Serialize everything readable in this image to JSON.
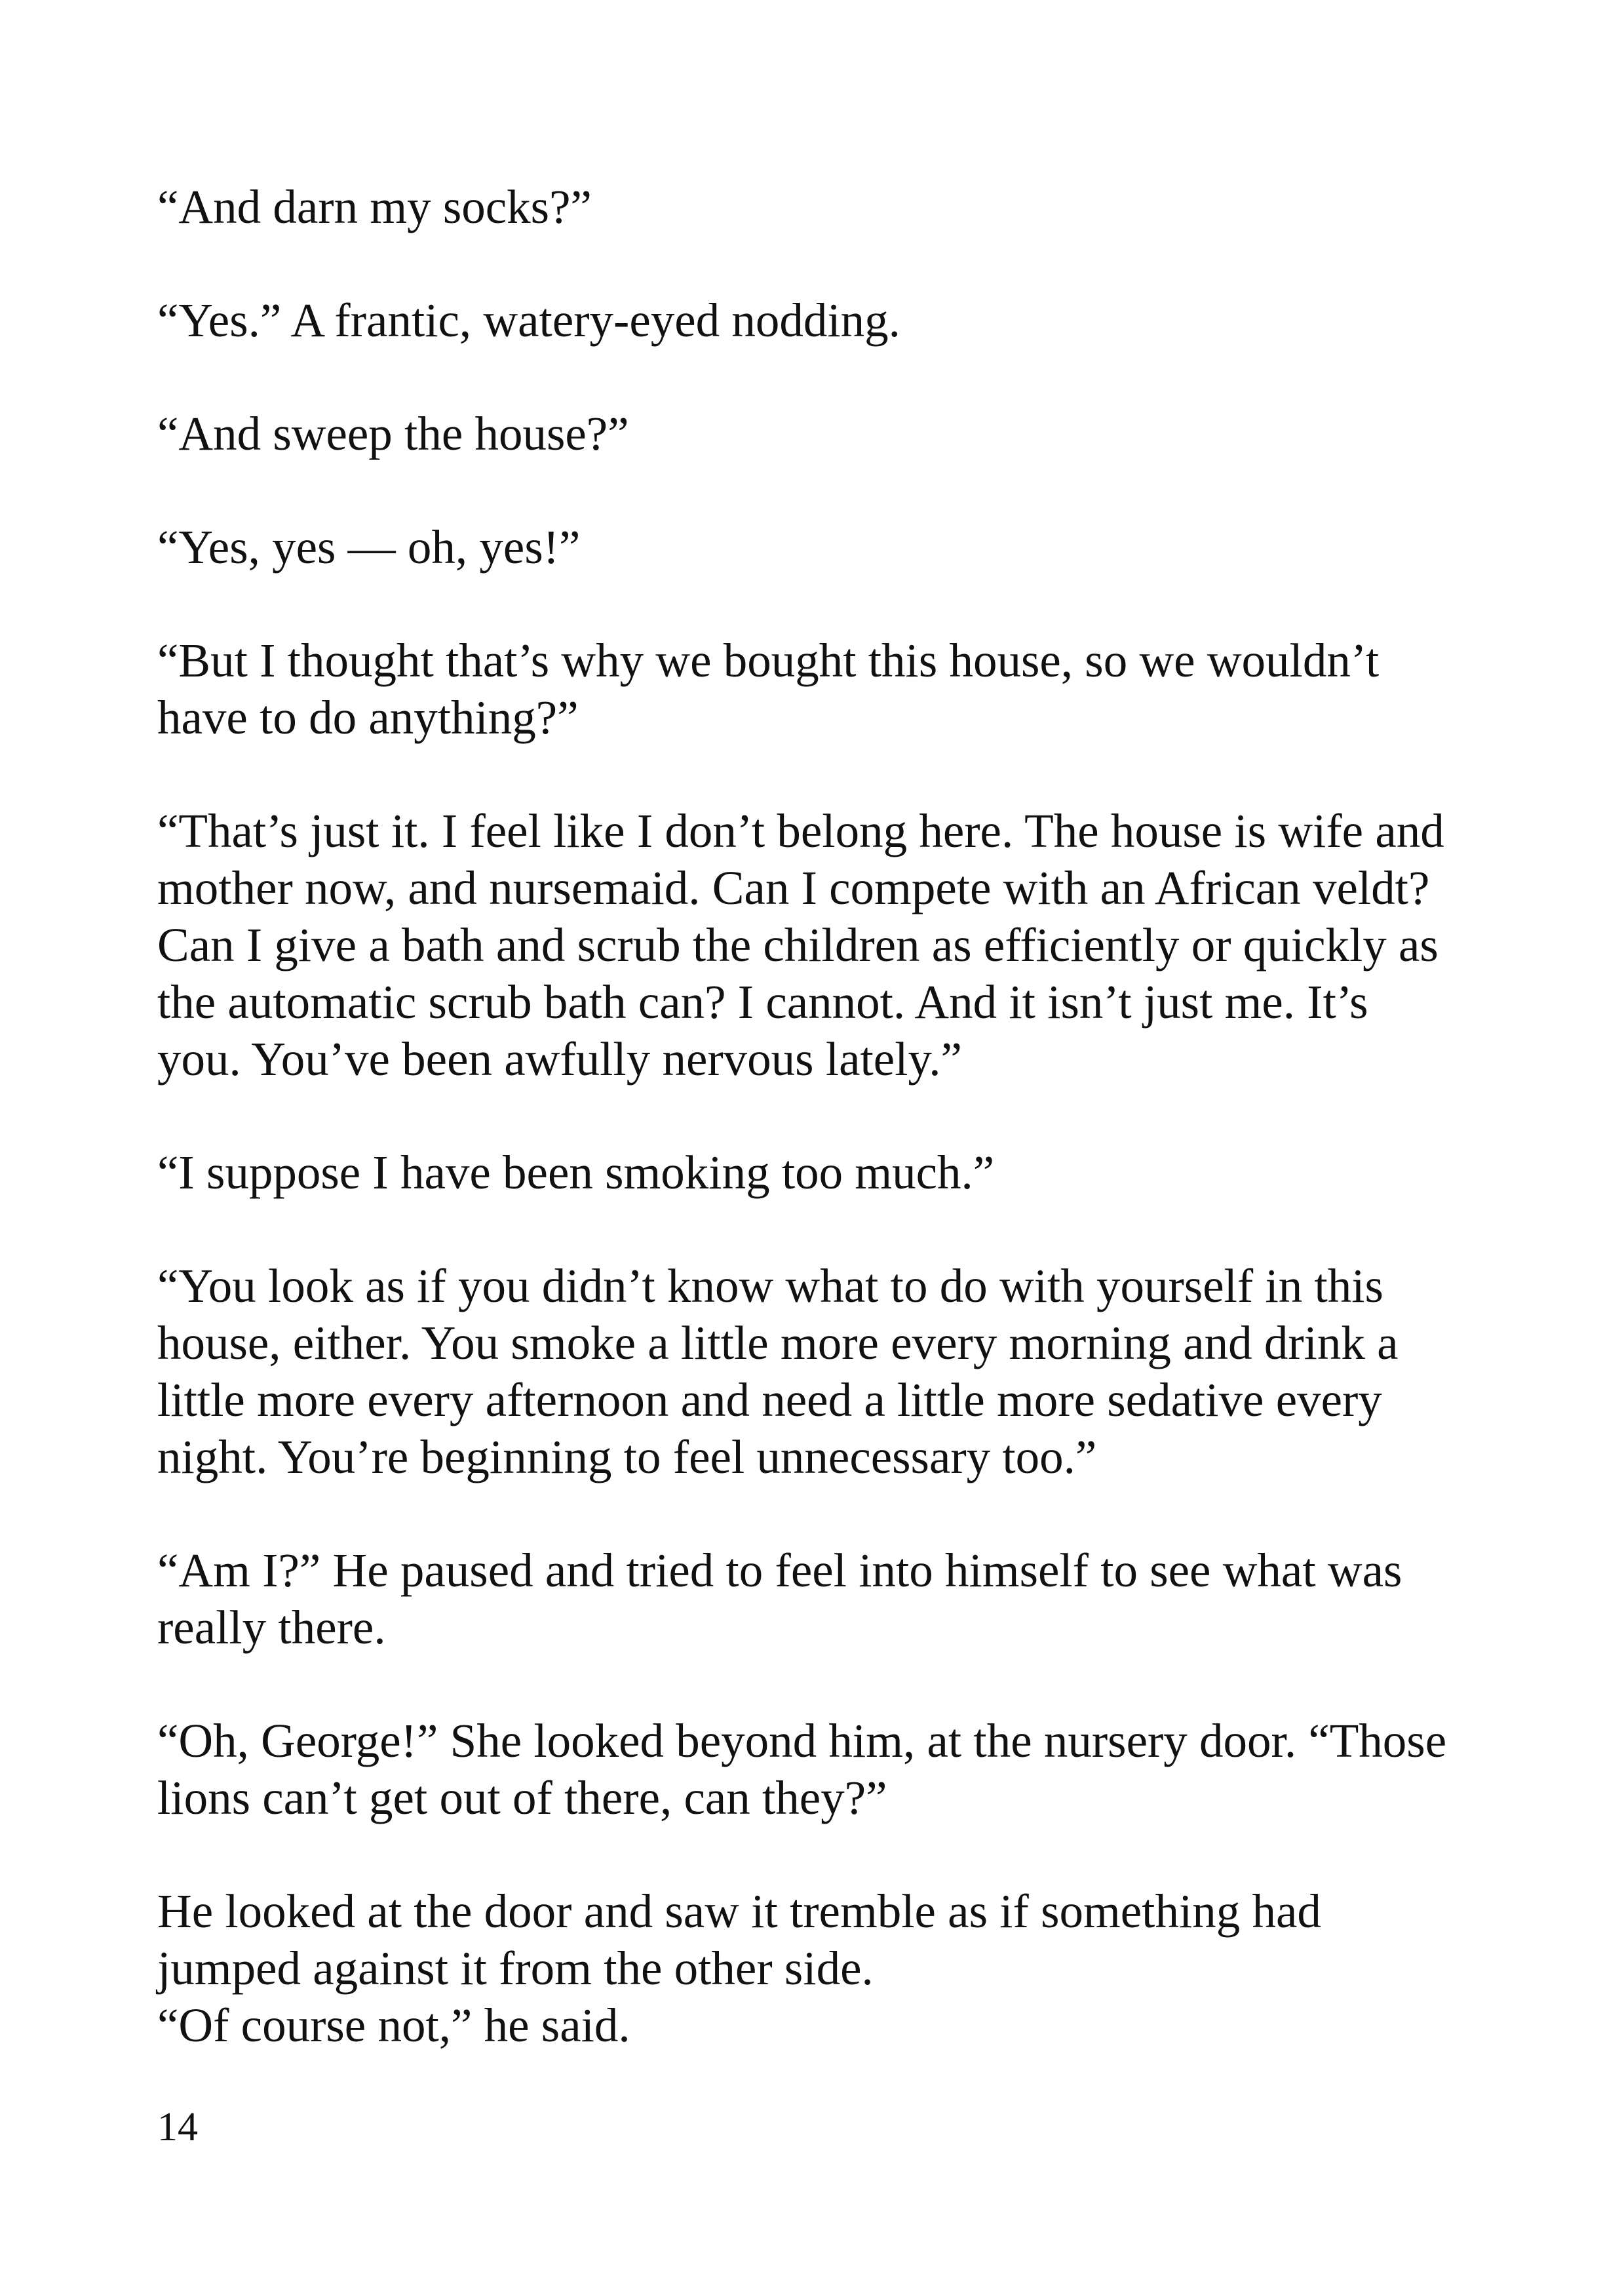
{
  "paragraphs": [
    {
      "lines": [
        "“And darn my socks?”"
      ]
    },
    {
      "lines": [
        "“Yes.” A frantic, watery-eyed nodding."
      ]
    },
    {
      "lines": [
        "“And sweep the house?”"
      ]
    },
    {
      "lines": [
        "“Yes, yes — oh, yes!”"
      ]
    },
    {
      "lines": [
        "“But I thought that’s why we bought this house, so we wouldn’t",
        "have to do anything?”"
      ]
    },
    {
      "lines": [
        "“That’s just it. I feel like I don’t belong here. The house is wife and",
        "mother now, and nursemaid. Can I compete with an African veldt?",
        "Can I give a bath and scrub the children as efficiently or quickly as",
        "the automatic scrub bath can? I cannot. And it isn’t just me. It’s",
        "you. You’ve been awfully nervous lately.”"
      ]
    },
    {
      "lines": [
        "“I suppose I have been smoking too much.”"
      ]
    },
    {
      "lines": [
        "“You look as if you didn’t know what to do with yourself in this",
        "house, either. You smoke a little more every morning and drink a",
        "little more every afternoon and need a little more sedative every",
        "night. You’re beginning to feel unnecessary too.”"
      ]
    },
    {
      "lines": [
        "“Am I?” He paused and tried to feel into himself to see what was",
        "really there."
      ]
    },
    {
      "lines": [
        "“Oh, George!” She looked beyond him, at the nursery door. “Those",
        "lions can’t get out of there, can they?”"
      ]
    },
    {
      "lines": [
        "He looked at the door and saw it tremble as if something had",
        "jumped against it from the other side.",
        "“Of course not,” he said."
      ]
    }
  ],
  "page_number": "14"
}
